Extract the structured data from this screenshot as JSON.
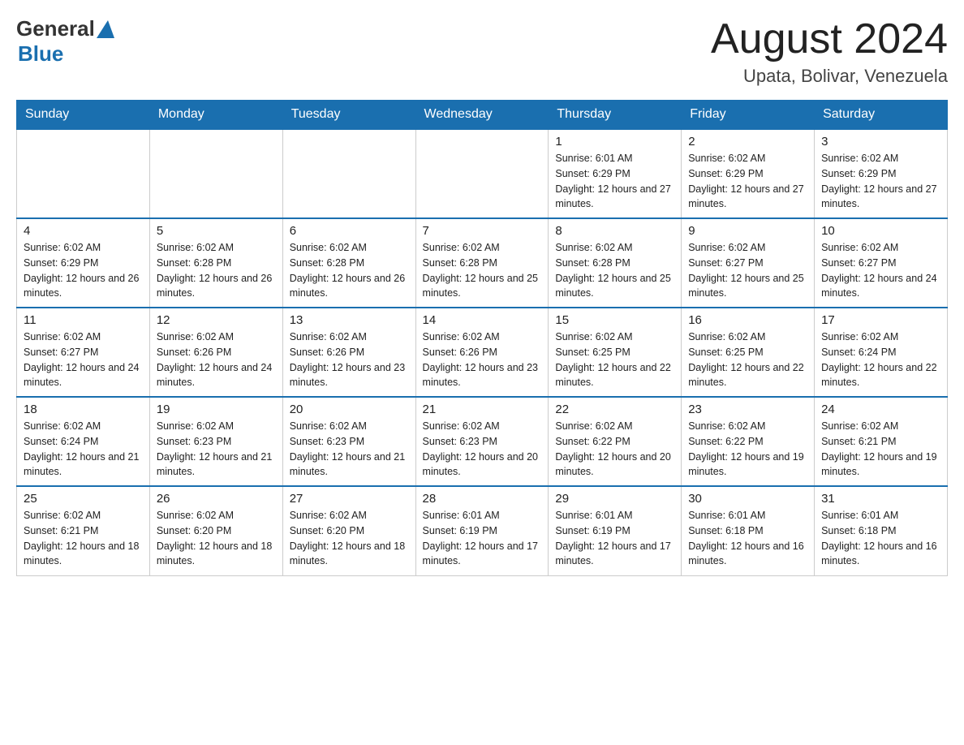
{
  "header": {
    "logo_general": "General",
    "logo_blue": "Blue",
    "month_title": "August 2024",
    "location": "Upata, Bolivar, Venezuela"
  },
  "calendar": {
    "days_of_week": [
      "Sunday",
      "Monday",
      "Tuesday",
      "Wednesday",
      "Thursday",
      "Friday",
      "Saturday"
    ],
    "weeks": [
      [
        {
          "day": "",
          "sunrise": "",
          "sunset": "",
          "daylight": ""
        },
        {
          "day": "",
          "sunrise": "",
          "sunset": "",
          "daylight": ""
        },
        {
          "day": "",
          "sunrise": "",
          "sunset": "",
          "daylight": ""
        },
        {
          "day": "",
          "sunrise": "",
          "sunset": "",
          "daylight": ""
        },
        {
          "day": "1",
          "sunrise": "Sunrise: 6:01 AM",
          "sunset": "Sunset: 6:29 PM",
          "daylight": "Daylight: 12 hours and 27 minutes."
        },
        {
          "day": "2",
          "sunrise": "Sunrise: 6:02 AM",
          "sunset": "Sunset: 6:29 PM",
          "daylight": "Daylight: 12 hours and 27 minutes."
        },
        {
          "day": "3",
          "sunrise": "Sunrise: 6:02 AM",
          "sunset": "Sunset: 6:29 PM",
          "daylight": "Daylight: 12 hours and 27 minutes."
        }
      ],
      [
        {
          "day": "4",
          "sunrise": "Sunrise: 6:02 AM",
          "sunset": "Sunset: 6:29 PM",
          "daylight": "Daylight: 12 hours and 26 minutes."
        },
        {
          "day": "5",
          "sunrise": "Sunrise: 6:02 AM",
          "sunset": "Sunset: 6:28 PM",
          "daylight": "Daylight: 12 hours and 26 minutes."
        },
        {
          "day": "6",
          "sunrise": "Sunrise: 6:02 AM",
          "sunset": "Sunset: 6:28 PM",
          "daylight": "Daylight: 12 hours and 26 minutes."
        },
        {
          "day": "7",
          "sunrise": "Sunrise: 6:02 AM",
          "sunset": "Sunset: 6:28 PM",
          "daylight": "Daylight: 12 hours and 25 minutes."
        },
        {
          "day": "8",
          "sunrise": "Sunrise: 6:02 AM",
          "sunset": "Sunset: 6:28 PM",
          "daylight": "Daylight: 12 hours and 25 minutes."
        },
        {
          "day": "9",
          "sunrise": "Sunrise: 6:02 AM",
          "sunset": "Sunset: 6:27 PM",
          "daylight": "Daylight: 12 hours and 25 minutes."
        },
        {
          "day": "10",
          "sunrise": "Sunrise: 6:02 AM",
          "sunset": "Sunset: 6:27 PM",
          "daylight": "Daylight: 12 hours and 24 minutes."
        }
      ],
      [
        {
          "day": "11",
          "sunrise": "Sunrise: 6:02 AM",
          "sunset": "Sunset: 6:27 PM",
          "daylight": "Daylight: 12 hours and 24 minutes."
        },
        {
          "day": "12",
          "sunrise": "Sunrise: 6:02 AM",
          "sunset": "Sunset: 6:26 PM",
          "daylight": "Daylight: 12 hours and 24 minutes."
        },
        {
          "day": "13",
          "sunrise": "Sunrise: 6:02 AM",
          "sunset": "Sunset: 6:26 PM",
          "daylight": "Daylight: 12 hours and 23 minutes."
        },
        {
          "day": "14",
          "sunrise": "Sunrise: 6:02 AM",
          "sunset": "Sunset: 6:26 PM",
          "daylight": "Daylight: 12 hours and 23 minutes."
        },
        {
          "day": "15",
          "sunrise": "Sunrise: 6:02 AM",
          "sunset": "Sunset: 6:25 PM",
          "daylight": "Daylight: 12 hours and 22 minutes."
        },
        {
          "day": "16",
          "sunrise": "Sunrise: 6:02 AM",
          "sunset": "Sunset: 6:25 PM",
          "daylight": "Daylight: 12 hours and 22 minutes."
        },
        {
          "day": "17",
          "sunrise": "Sunrise: 6:02 AM",
          "sunset": "Sunset: 6:24 PM",
          "daylight": "Daylight: 12 hours and 22 minutes."
        }
      ],
      [
        {
          "day": "18",
          "sunrise": "Sunrise: 6:02 AM",
          "sunset": "Sunset: 6:24 PM",
          "daylight": "Daylight: 12 hours and 21 minutes."
        },
        {
          "day": "19",
          "sunrise": "Sunrise: 6:02 AM",
          "sunset": "Sunset: 6:23 PM",
          "daylight": "Daylight: 12 hours and 21 minutes."
        },
        {
          "day": "20",
          "sunrise": "Sunrise: 6:02 AM",
          "sunset": "Sunset: 6:23 PM",
          "daylight": "Daylight: 12 hours and 21 minutes."
        },
        {
          "day": "21",
          "sunrise": "Sunrise: 6:02 AM",
          "sunset": "Sunset: 6:23 PM",
          "daylight": "Daylight: 12 hours and 20 minutes."
        },
        {
          "day": "22",
          "sunrise": "Sunrise: 6:02 AM",
          "sunset": "Sunset: 6:22 PM",
          "daylight": "Daylight: 12 hours and 20 minutes."
        },
        {
          "day": "23",
          "sunrise": "Sunrise: 6:02 AM",
          "sunset": "Sunset: 6:22 PM",
          "daylight": "Daylight: 12 hours and 19 minutes."
        },
        {
          "day": "24",
          "sunrise": "Sunrise: 6:02 AM",
          "sunset": "Sunset: 6:21 PM",
          "daylight": "Daylight: 12 hours and 19 minutes."
        }
      ],
      [
        {
          "day": "25",
          "sunrise": "Sunrise: 6:02 AM",
          "sunset": "Sunset: 6:21 PM",
          "daylight": "Daylight: 12 hours and 18 minutes."
        },
        {
          "day": "26",
          "sunrise": "Sunrise: 6:02 AM",
          "sunset": "Sunset: 6:20 PM",
          "daylight": "Daylight: 12 hours and 18 minutes."
        },
        {
          "day": "27",
          "sunrise": "Sunrise: 6:02 AM",
          "sunset": "Sunset: 6:20 PM",
          "daylight": "Daylight: 12 hours and 18 minutes."
        },
        {
          "day": "28",
          "sunrise": "Sunrise: 6:01 AM",
          "sunset": "Sunset: 6:19 PM",
          "daylight": "Daylight: 12 hours and 17 minutes."
        },
        {
          "day": "29",
          "sunrise": "Sunrise: 6:01 AM",
          "sunset": "Sunset: 6:19 PM",
          "daylight": "Daylight: 12 hours and 17 minutes."
        },
        {
          "day": "30",
          "sunrise": "Sunrise: 6:01 AM",
          "sunset": "Sunset: 6:18 PM",
          "daylight": "Daylight: 12 hours and 16 minutes."
        },
        {
          "day": "31",
          "sunrise": "Sunrise: 6:01 AM",
          "sunset": "Sunset: 6:18 PM",
          "daylight": "Daylight: 12 hours and 16 minutes."
        }
      ]
    ]
  }
}
